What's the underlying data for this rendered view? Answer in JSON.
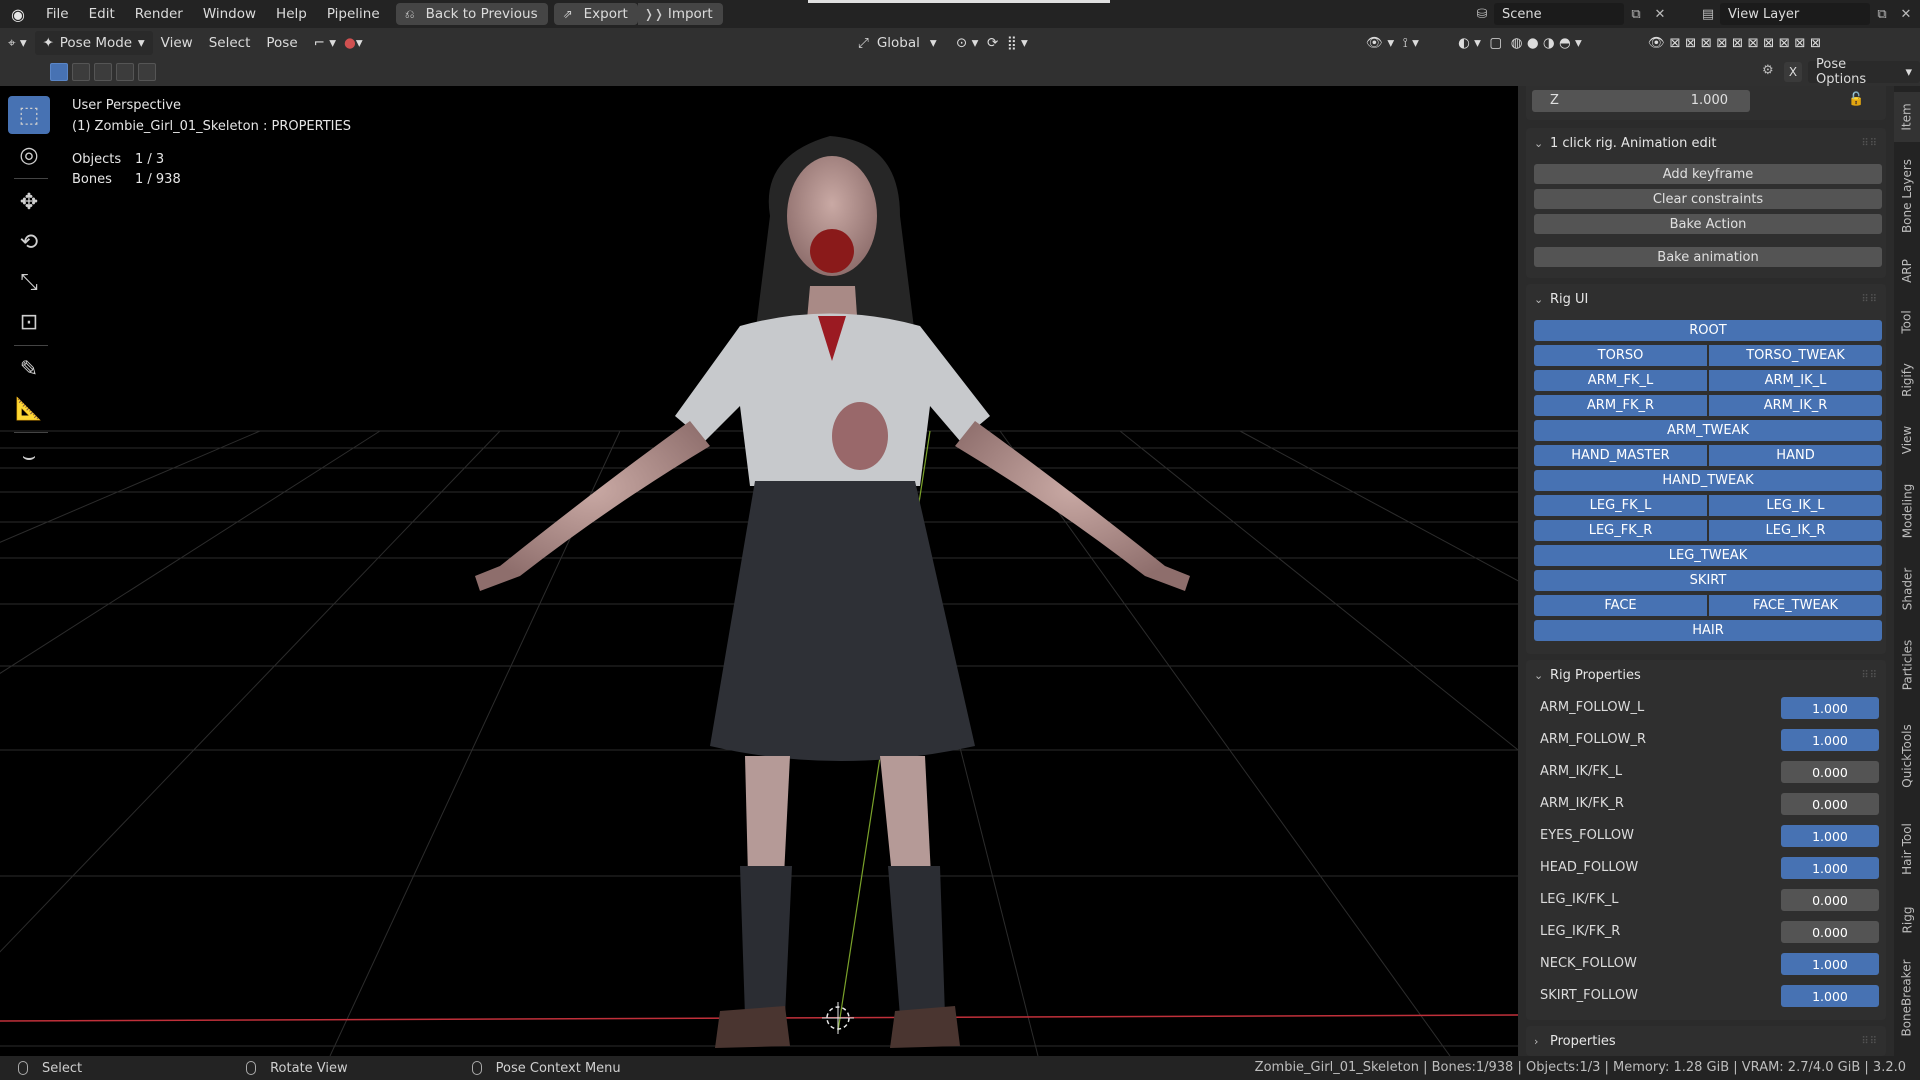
{
  "menu": {
    "items": [
      "File",
      "Edit",
      "Render",
      "Window",
      "Help",
      "Pipeline"
    ],
    "back_to_previous": "Back to Previous",
    "export": "Export",
    "import": "Import"
  },
  "scene": {
    "label": "Scene"
  },
  "view_layer": {
    "label": "View Layer"
  },
  "header": {
    "mode": "Pose Mode",
    "menus": [
      "View",
      "Select",
      "Pose"
    ],
    "transform_orientation": "Global",
    "pose_options": "Pose Options"
  },
  "viewport": {
    "perspective": "User Perspective",
    "object_info": "(1) Zombie_Girl_01_Skeleton : PROPERTIES",
    "objects_label": "Objects",
    "objects_value": "1 / 3",
    "bones_label": "Bones",
    "bones_value": "1 / 938"
  },
  "transform": {
    "z_label": "Z",
    "z_value": "1.000"
  },
  "animation_panel": {
    "title": "1 click rig. Animation edit",
    "add_keyframe": "Add keyframe",
    "clear_constraints": "Clear constraints",
    "bake_action": "Bake Action",
    "bake_animation": "Bake animation"
  },
  "rig_ui": {
    "title": "Rig UI",
    "root": "ROOT",
    "torso": "TORSO",
    "torso_tweak": "TORSO_TWEAK",
    "arm_fk_l": "ARM_FK_L",
    "arm_ik_l": "ARM_IK_L",
    "arm_fk_r": "ARM_FK_R",
    "arm_ik_r": "ARM_IK_R",
    "arm_tweak": "ARM_TWEAK",
    "hand_master": "HAND_MASTER",
    "hand": "HAND",
    "hand_tweak": "HAND_TWEAK",
    "leg_fk_l": "LEG_FK_L",
    "leg_ik_l": "LEG_IK_L",
    "leg_fk_r": "LEG_FK_R",
    "leg_ik_r": "LEG_IK_R",
    "leg_tweak": "LEG_TWEAK",
    "skirt": "SKIRT",
    "face": "FACE",
    "face_tweak": "FACE_TWEAK",
    "hair": "HAIR"
  },
  "rig_properties": {
    "title": "Rig Properties",
    "rows": [
      {
        "name": "ARM_FOLLOW_L",
        "value": "1.000"
      },
      {
        "name": "ARM_FOLLOW_R",
        "value": "1.000"
      },
      {
        "name": "ARM_IK/FK_L",
        "value": "0.000"
      },
      {
        "name": "ARM_IK/FK_R",
        "value": "0.000"
      },
      {
        "name": "EYES_FOLLOW",
        "value": "1.000"
      },
      {
        "name": "HEAD_FOLLOW",
        "value": "1.000"
      },
      {
        "name": "LEG_IK/FK_L",
        "value": "0.000"
      },
      {
        "name": "LEG_IK/FK_R",
        "value": "0.000"
      },
      {
        "name": "NECK_FOLLOW",
        "value": "1.000"
      },
      {
        "name": "SKIRT_FOLLOW",
        "value": "1.000"
      }
    ]
  },
  "properties_panel": {
    "title": "Properties"
  },
  "sidebar_tabs": [
    "Item",
    "Bone Layers",
    "ARP",
    "Tool",
    "Rigify",
    "View",
    "Modeling",
    "Shader",
    "Particles",
    "QuickTools",
    "Hair Tool",
    "Rigg",
    "BoneBreaker"
  ],
  "status": {
    "select": "Select",
    "rotate_view": "Rotate View",
    "pose_context_menu": "Pose Context Menu",
    "info": "Zombie_Girl_01_Skeleton | Bones:1/938 | Objects:1/3 | Memory: 1.28 GiB | VRAM: 2.7/4.0 GiB | 3.2.0"
  },
  "colors": {
    "accent": "#4772b3",
    "viewport_bg": "#000000",
    "x_axis": "#c0303a",
    "y_axis": "#7aa22a"
  }
}
